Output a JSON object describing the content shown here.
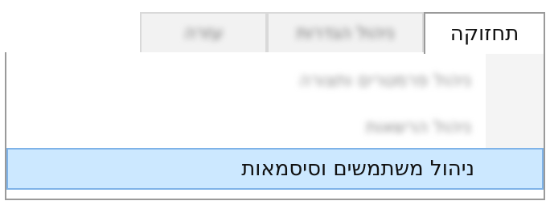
{
  "tabs": [
    {
      "label": "תחזוקה",
      "active": true
    },
    {
      "label": "ניהול הגדרות",
      "active": false
    },
    {
      "label": "עזרה",
      "active": false
    }
  ],
  "menu": {
    "items": [
      {
        "label": "ניהול פרמטרים ותצורה"
      },
      {
        "label": "ניהול הרשאות"
      },
      {
        "label": "ניהול משתמשים וסיסמאות",
        "highlighted": true
      }
    ]
  },
  "colors": {
    "highlight_bg": "#cce8ff",
    "highlight_border": "#7fb3e8",
    "border": "#9a9a9a"
  }
}
